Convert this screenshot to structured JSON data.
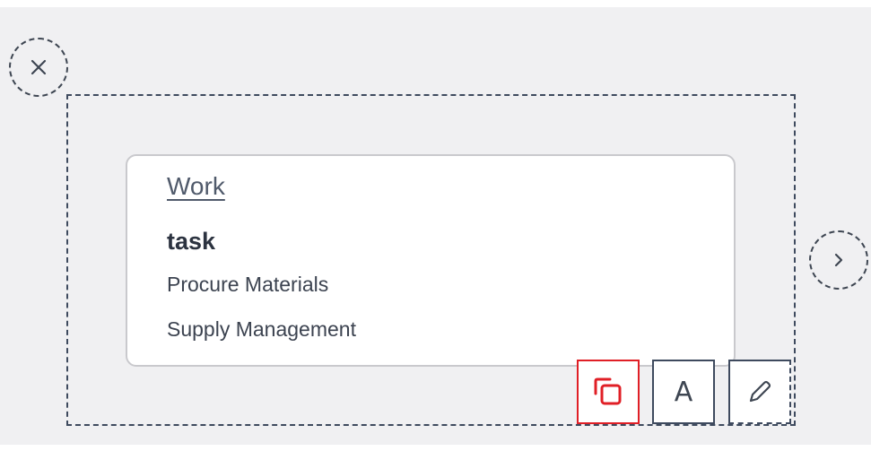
{
  "card": {
    "title": "Work",
    "type": "task",
    "line1": "Procure Materials",
    "line2": "Supply Management"
  },
  "toolbar": {
    "font_label": "A"
  },
  "icons": {
    "close": "close-icon",
    "next": "chevron-right-icon",
    "copy": "duplicate-icon",
    "edit": "pencil-icon"
  },
  "colors": {
    "canvas_bg": "#f0f0f2",
    "selection_border": "#3e4a5e",
    "active_tool": "#e01f26"
  }
}
